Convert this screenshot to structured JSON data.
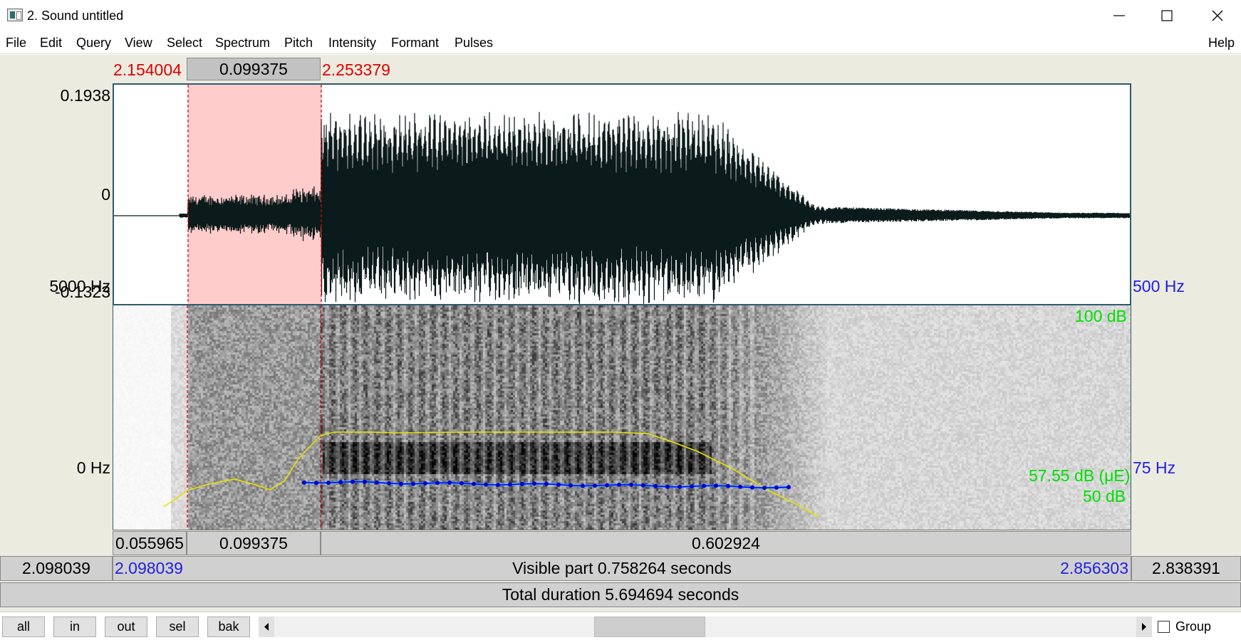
{
  "window": {
    "title": "2. Sound untitled"
  },
  "menu": {
    "items": [
      "File",
      "Edit",
      "Query",
      "View",
      "Select",
      "Spectrum",
      "Pitch",
      "Intensity",
      "Formant",
      "Pulses"
    ],
    "help": "Help"
  },
  "selection": {
    "start": "2.154004",
    "duration": "0.099375",
    "end": "2.253379"
  },
  "waveform": {
    "y_max": "0.1938",
    "y_zero": "0",
    "y_min": "-0.1323"
  },
  "spectrogram": {
    "freq_top": "5000 Hz",
    "freq_bottom": "0 Hz",
    "intensity_top": "100 dB",
    "pitch_top": "500 Hz",
    "intensity_value": "57.55 dB (μE)",
    "intensity_bottom": "50 dB",
    "pitch_bottom": "75 Hz"
  },
  "segments": {
    "before": "0.055965",
    "selected": "0.099375",
    "after": "0.602924"
  },
  "visible": {
    "window_start": "2.098039",
    "start": "2.098039",
    "label": "Visible part 0.758264 seconds",
    "end": "2.856303",
    "window_end": "2.838391"
  },
  "total": {
    "label": "Total duration 5.694694 seconds"
  },
  "toolbar": {
    "all": "all",
    "in": "in",
    "out": "out",
    "sel": "sel",
    "bak": "bak",
    "group_label": "Group"
  },
  "colors": {
    "selection_fill": "#ffcccc",
    "cursor_line": "#e00000",
    "pitch_curve": "#0000ff",
    "intensity_curve": "#e8e000",
    "intensity_text": "#00e000",
    "pitch_text": "#2020e0",
    "panel_border": "#2b5b6e",
    "editor_background": "#ecebe0"
  }
}
